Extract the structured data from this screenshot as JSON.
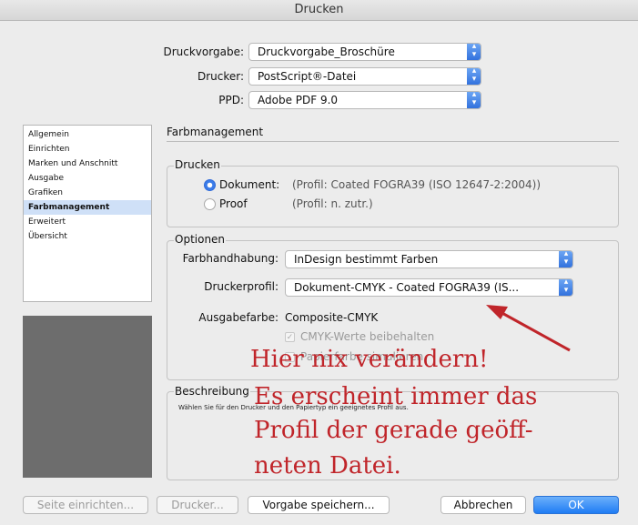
{
  "window": {
    "title": "Drucken"
  },
  "top": {
    "preset_label": "Druckvorgabe:",
    "preset_value": "Druckvorgabe_Broschüre",
    "printer_label": "Drucker:",
    "printer_value": "PostScript®-Datei",
    "ppd_label": "PPD:",
    "ppd_value": "Adobe PDF 9.0"
  },
  "sidebar": {
    "items": [
      {
        "label": "Allgemein"
      },
      {
        "label": "Einrichten"
      },
      {
        "label": "Marken und Anschnitt"
      },
      {
        "label": "Ausgabe"
      },
      {
        "label": "Grafiken"
      },
      {
        "label": "Farbmanagement"
      },
      {
        "label": "Erweitert"
      },
      {
        "label": "Übersicht"
      }
    ],
    "selected_index": 5
  },
  "main": {
    "section_title": "Farbmanagement",
    "print_group": {
      "title": "Drucken",
      "document_label": "Dokument:",
      "document_profile": "(Profil: Coated FOGRA39 (ISO 12647-2:2004))",
      "proof_label": "Proof",
      "proof_profile": "(Profil: n. zutr.)"
    },
    "options_group": {
      "title": "Optionen",
      "color_handling_label": "Farbhandhabung:",
      "color_handling_value": "InDesign bestimmt Farben",
      "printer_profile_label": "Druckerprofil:",
      "printer_profile_value": "Dokument-CMYK - Coated FOGRA39 (IS...",
      "output_color_label": "Ausgabefarbe:",
      "output_color_value": "Composite-CMYK",
      "preserve_cmyk_label": "CMYK-Werte beibehalten",
      "simulate_paper_label": "Papierfarbe simulieren"
    },
    "description_group": {
      "title": "Beschreibung",
      "text": "Wählen Sie für den Drucker und den Papiertyp ein geeignetes Profil aus."
    }
  },
  "annotation": {
    "line1": "Hier nix verändern!",
    "line2": "Es erscheint immer das",
    "line3": "Profil der gerade geöff-",
    "line4": "neten Datei.",
    "color": "#c0252a"
  },
  "footer": {
    "page_setup": "Seite einrichten...",
    "printer": "Drucker...",
    "save_preset": "Vorgabe speichern...",
    "cancel": "Abbrechen",
    "ok": "OK"
  }
}
